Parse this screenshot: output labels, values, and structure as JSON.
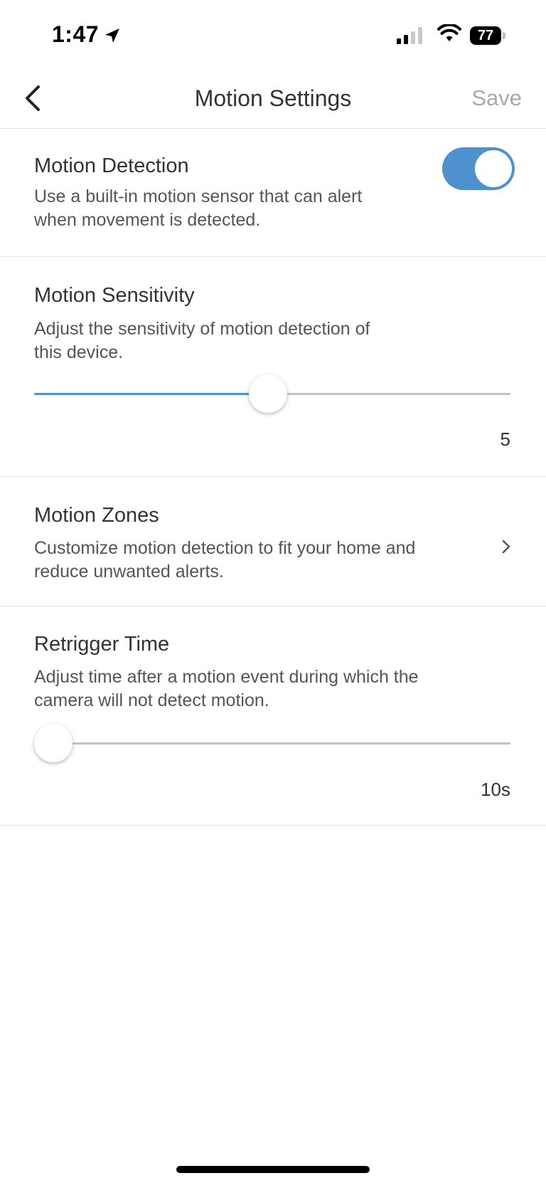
{
  "status_bar": {
    "time": "1:47",
    "battery_percent": "77",
    "location_icon": "location-arrow-icon",
    "signal_icon": "cellular-signal-icon",
    "wifi_icon": "wifi-icon"
  },
  "nav": {
    "back_icon": "chevron-left-icon",
    "title": "Motion Settings",
    "save_label": "Save"
  },
  "motion_detection": {
    "title": "Motion Detection",
    "description_line1": "Use a built-in motion sensor that can alert",
    "description_line2": "when movement is detected.",
    "enabled": true
  },
  "motion_sensitivity": {
    "title": "Motion Sensitivity",
    "description_line1": "Adjust the sensitivity of motion detection of",
    "description_line2": "this device.",
    "value": 5,
    "value_label": "5",
    "slider_fraction": 0.49
  },
  "motion_zones": {
    "title": "Motion Zones",
    "description_line1": "Customize motion detection to fit your home and",
    "description_line2": "reduce unwanted alerts.",
    "chevron_icon": "chevron-right-icon"
  },
  "retrigger_time": {
    "title": "Retrigger Time",
    "description_line1": "Adjust time after a motion event during which the",
    "description_line2": "camera will not detect motion.",
    "value_label": "10s",
    "slider_fraction": 0.0
  },
  "colors": {
    "accent": "#4e91cf",
    "save_disabled": "#a9a9a9"
  }
}
